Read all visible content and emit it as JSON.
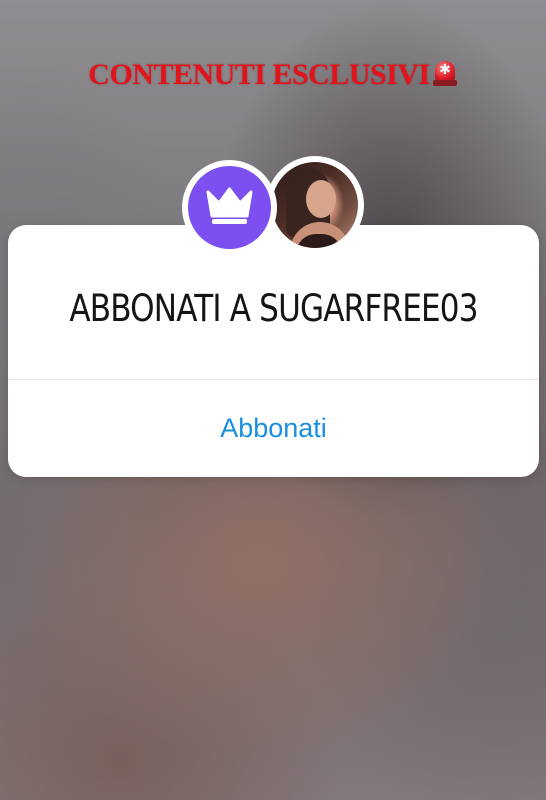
{
  "promo": {
    "title": "CONTENUTI ESCLUSIVI",
    "emoji_icon": "rotating-light-icon",
    "color": "#e1131b"
  },
  "card": {
    "title": "ABBONATI A SUGARFREE03",
    "action_label": "Abbonati",
    "action_color": "#1a8fe0"
  },
  "badges": {
    "crown_icon": "crown-icon",
    "crown_color": "#7b4ff0",
    "avatar": "profile-avatar"
  }
}
